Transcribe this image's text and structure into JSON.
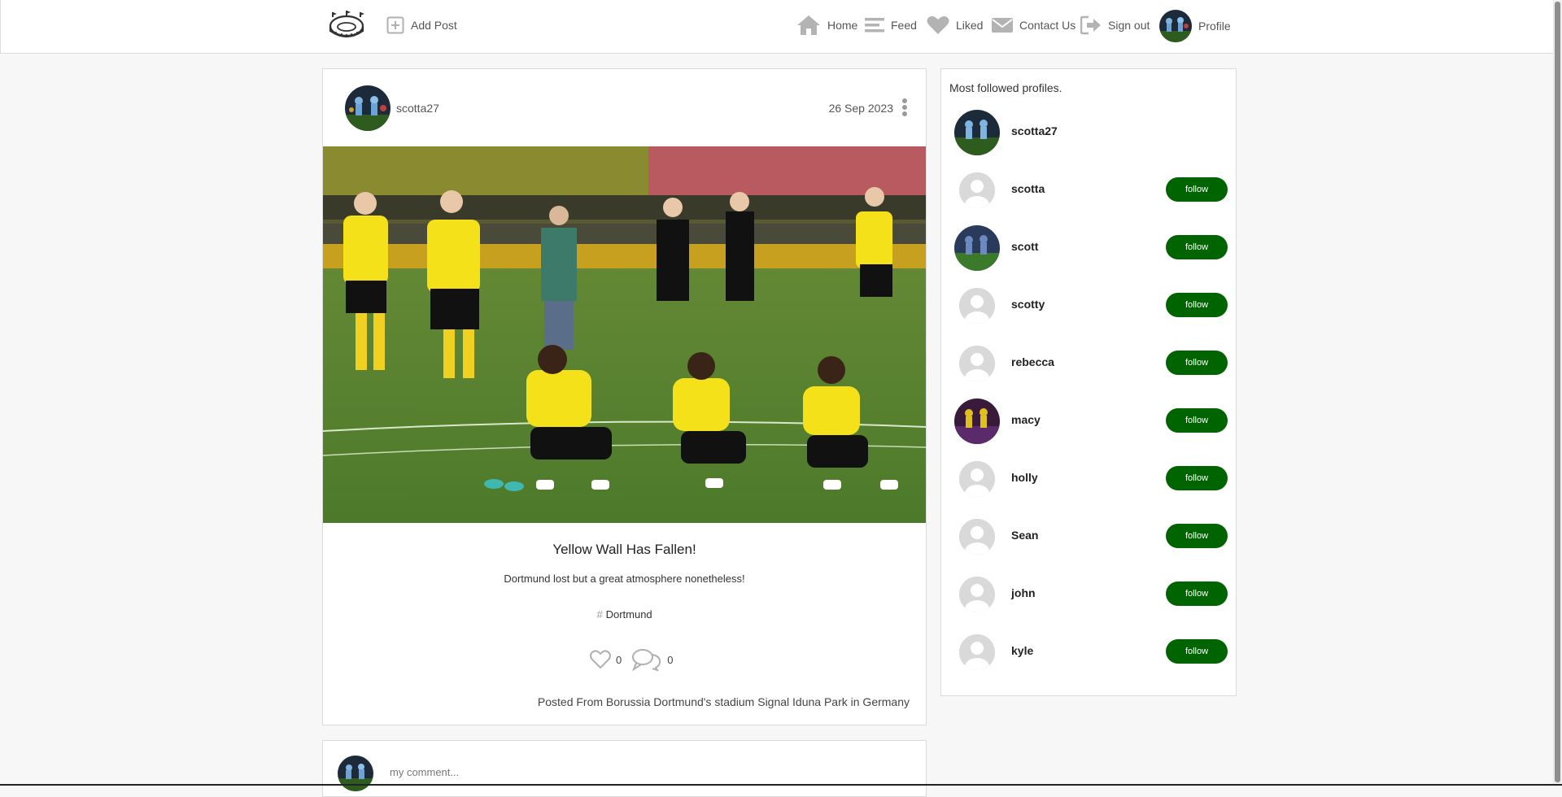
{
  "nav": {
    "logo_icon": "stadium-icon",
    "add_post": "Add Post",
    "home": "Home",
    "feed": "Feed",
    "liked": "Liked",
    "contact": "Contact Us",
    "signout": "Sign out",
    "profile": "Profile"
  },
  "post": {
    "author": "scotta27",
    "date": "26 Sep 2023",
    "title": "Yellow Wall Has Fallen!",
    "body": "Dortmund lost but a great atmosphere nonetheless!",
    "hash": "#",
    "tag": "Dortmund",
    "likes": "0",
    "comments": "0",
    "location": "Posted From Borussia Dortmund's stadium Signal Iduna Park in Germany"
  },
  "comment": {
    "placeholder": "my comment..."
  },
  "sidebar": {
    "title": "Most followed profiles.",
    "follow_label": "follow",
    "profiles": [
      {
        "name": "scotta27",
        "avatar": "photo"
      },
      {
        "name": "scotta",
        "avatar": "default"
      },
      {
        "name": "scott",
        "avatar": "photo"
      },
      {
        "name": "scotty",
        "avatar": "default"
      },
      {
        "name": "rebecca",
        "avatar": "default"
      },
      {
        "name": "macy",
        "avatar": "photo"
      },
      {
        "name": "holly",
        "avatar": "default"
      },
      {
        "name": "Sean",
        "avatar": "default"
      },
      {
        "name": "john",
        "avatar": "default"
      },
      {
        "name": "kyle",
        "avatar": "default"
      }
    ]
  },
  "colors": {
    "follow_button": "#006400",
    "page_background": "#f7f7f7"
  }
}
